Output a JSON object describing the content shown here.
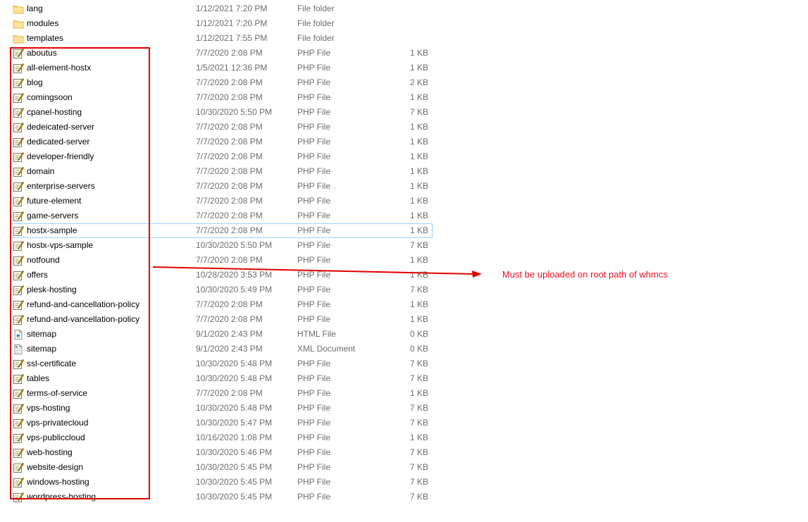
{
  "files": [
    {
      "name": "lang",
      "date": "1/12/2021 7:20 PM",
      "type": "File folder",
      "size": "",
      "icon": "folder-icon"
    },
    {
      "name": "modules",
      "date": "1/12/2021 7:20 PM",
      "type": "File folder",
      "size": "",
      "icon": "folder-icon"
    },
    {
      "name": "templates",
      "date": "1/12/2021 7:55 PM",
      "type": "File folder",
      "size": "",
      "icon": "folder-icon"
    },
    {
      "name": "aboutus",
      "date": "7/7/2020 2:08 PM",
      "type": "PHP File",
      "size": "1 KB",
      "icon": "php-file-icon"
    },
    {
      "name": "all-element-hostx",
      "date": "1/5/2021 12:36 PM",
      "type": "PHP File",
      "size": "1 KB",
      "icon": "php-file-icon"
    },
    {
      "name": "blog",
      "date": "7/7/2020 2:08 PM",
      "type": "PHP File",
      "size": "2 KB",
      "icon": "php-file-icon"
    },
    {
      "name": "comingsoon",
      "date": "7/7/2020 2:08 PM",
      "type": "PHP File",
      "size": "1 KB",
      "icon": "php-file-icon"
    },
    {
      "name": "cpanel-hosting",
      "date": "10/30/2020 5:50 PM",
      "type": "PHP File",
      "size": "7 KB",
      "icon": "php-file-icon"
    },
    {
      "name": "dedeicated-server",
      "date": "7/7/2020 2:08 PM",
      "type": "PHP File",
      "size": "1 KB",
      "icon": "php-file-icon"
    },
    {
      "name": "dedicated-server",
      "date": "7/7/2020 2:08 PM",
      "type": "PHP File",
      "size": "1 KB",
      "icon": "php-file-icon"
    },
    {
      "name": "developer-friendly",
      "date": "7/7/2020 2:08 PM",
      "type": "PHP File",
      "size": "1 KB",
      "icon": "php-file-icon"
    },
    {
      "name": "domain",
      "date": "7/7/2020 2:08 PM",
      "type": "PHP File",
      "size": "1 KB",
      "icon": "php-file-icon"
    },
    {
      "name": "enterprise-servers",
      "date": "7/7/2020 2:08 PM",
      "type": "PHP File",
      "size": "1 KB",
      "icon": "php-file-icon"
    },
    {
      "name": "future-element",
      "date": "7/7/2020 2:08 PM",
      "type": "PHP File",
      "size": "1 KB",
      "icon": "php-file-icon"
    },
    {
      "name": "game-servers",
      "date": "7/7/2020 2:08 PM",
      "type": "PHP File",
      "size": "1 KB",
      "icon": "php-file-icon"
    },
    {
      "name": "hostx-sample",
      "date": "7/7/2020 2:08 PM",
      "type": "PHP File",
      "size": "1 KB",
      "icon": "php-file-icon",
      "selected": true
    },
    {
      "name": "hostx-vps-sample",
      "date": "10/30/2020 5:50 PM",
      "type": "PHP File",
      "size": "7 KB",
      "icon": "php-file-icon"
    },
    {
      "name": "notfound",
      "date": "7/7/2020 2:08 PM",
      "type": "PHP File",
      "size": "1 KB",
      "icon": "php-file-icon"
    },
    {
      "name": "offers",
      "date": "10/28/2020 3:53 PM",
      "type": "PHP File",
      "size": "1 KB",
      "icon": "php-file-icon"
    },
    {
      "name": "plesk-hosting",
      "date": "10/30/2020 5:49 PM",
      "type": "PHP File",
      "size": "7 KB",
      "icon": "php-file-icon"
    },
    {
      "name": "refund-and-cancellation-policy",
      "date": "7/7/2020 2:08 PM",
      "type": "PHP File",
      "size": "1 KB",
      "icon": "php-file-icon"
    },
    {
      "name": "refund-and-vancellation-policy",
      "date": "7/7/2020 2:08 PM",
      "type": "PHP File",
      "size": "1 KB",
      "icon": "php-file-icon"
    },
    {
      "name": "sitemap",
      "date": "9/1/2020 2:43 PM",
      "type": "HTML File",
      "size": "0 KB",
      "icon": "html-file-icon"
    },
    {
      "name": "sitemap",
      "date": "9/1/2020 2:43 PM",
      "type": "XML Document",
      "size": "0 KB",
      "icon": "xml-file-icon"
    },
    {
      "name": "ssl-certificate",
      "date": "10/30/2020 5:48 PM",
      "type": "PHP File",
      "size": "7 KB",
      "icon": "php-file-icon"
    },
    {
      "name": "tables",
      "date": "10/30/2020 5:48 PM",
      "type": "PHP File",
      "size": "7 KB",
      "icon": "php-file-icon"
    },
    {
      "name": "terms-of-service",
      "date": "7/7/2020 2:08 PM",
      "type": "PHP File",
      "size": "1 KB",
      "icon": "php-file-icon"
    },
    {
      "name": "vps-hosting",
      "date": "10/30/2020 5:48 PM",
      "type": "PHP File",
      "size": "7 KB",
      "icon": "php-file-icon"
    },
    {
      "name": "vps-privatecloud",
      "date": "10/30/2020 5:47 PM",
      "type": "PHP File",
      "size": "7 KB",
      "icon": "php-file-icon"
    },
    {
      "name": "vps-publiccloud",
      "date": "10/16/2020 1:08 PM",
      "type": "PHP File",
      "size": "1 KB",
      "icon": "php-file-icon"
    },
    {
      "name": "web-hosting",
      "date": "10/30/2020 5:46 PM",
      "type": "PHP File",
      "size": "7 KB",
      "icon": "php-file-icon"
    },
    {
      "name": "website-design",
      "date": "10/30/2020 5:45 PM",
      "type": "PHP File",
      "size": "7 KB",
      "icon": "php-file-icon"
    },
    {
      "name": "windows-hosting",
      "date": "10/30/2020 5:45 PM",
      "type": "PHP File",
      "size": "7 KB",
      "icon": "php-file-icon"
    },
    {
      "name": "wordpress-hosting",
      "date": "10/30/2020 5:45 PM",
      "type": "PHP File",
      "size": "7 KB",
      "icon": "php-file-icon"
    }
  ],
  "annotation": {
    "text": "Must be uploaded on root path of whmcs",
    "color": "#e81123"
  },
  "colors": {
    "highlight_box": "#e00000",
    "selection_outline": "#99d1ff",
    "secondary_text": "#6d6d6d"
  }
}
